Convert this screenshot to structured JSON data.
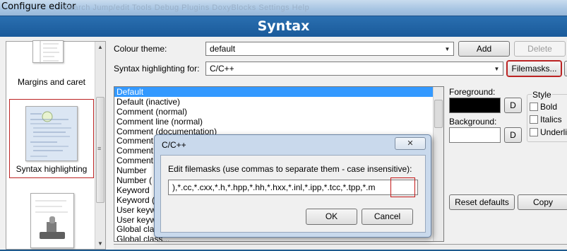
{
  "window": {
    "title": "Configure editor",
    "ghost_menu": "Search  Jump/edit  Tools  Debug  Plugins  DoxyBlocks  Settings  Help"
  },
  "header": {
    "title": "Syntax"
  },
  "left_panel": {
    "items": [
      {
        "label": "Margins and caret"
      },
      {
        "label": "Syntax highlighting"
      },
      {
        "label": ""
      }
    ]
  },
  "colour_theme": {
    "label": "Colour theme:",
    "value": "default"
  },
  "syntax_for": {
    "label": "Syntax highlighting for:",
    "value": "C/C++"
  },
  "buttons": {
    "add": "Add",
    "delete": "Delete",
    "filemasks": "Filemasks...",
    "reset_defaults": "Reset defaults",
    "copy": "Copy",
    "d1": "D",
    "d2": "D"
  },
  "styles": [
    "Default",
    "Default (inactive)",
    "Comment (normal)",
    "Comment line (normal)",
    "Comment (documentation)",
    "Comment",
    "Comment",
    "Comment",
    "Number",
    "Number (",
    "Keyword",
    "Keyword (",
    "User keyw",
    "User keyw",
    "Global clas",
    "Global class..."
  ],
  "foreground": {
    "label": "Foreground:",
    "color": "#000000"
  },
  "background": {
    "label": "Background:",
    "color": "#ffffff"
  },
  "style_group": {
    "title": "Style",
    "bold": "Bold",
    "italics": "Italics",
    "underline": "Underlin"
  },
  "dialog": {
    "title": "C/C++",
    "close_glyph": "✕",
    "prompt": "Edit filemasks (use commas to separate them - case insensitive):",
    "value": "),*.cc,*.cxx,*.h,*.hpp,*.hh,*.hxx,*.inl,*.ipp,*.tcc,*.tpp,*.m",
    "ok": "OK",
    "cancel": "Cancel"
  },
  "colors": {
    "header_blue": "#1f5e9f",
    "selection": "#3399ff",
    "highlight_red": "#c31818"
  }
}
